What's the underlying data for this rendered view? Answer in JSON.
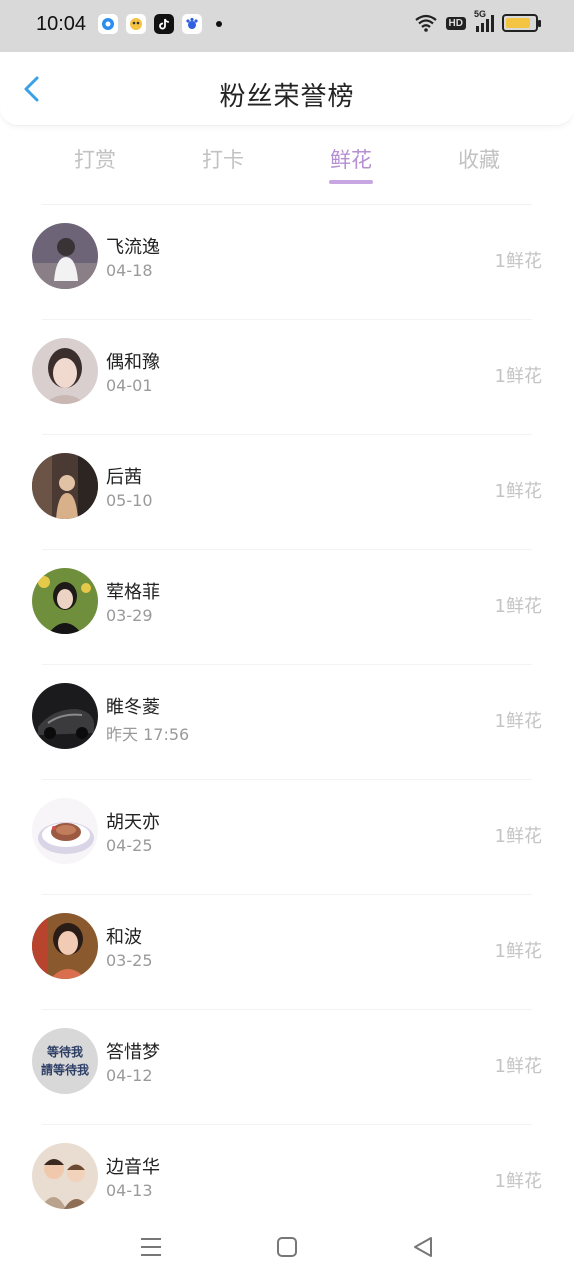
{
  "status": {
    "time": "10:04",
    "hd": "HD",
    "network": "5G",
    "battery_level": 0.85
  },
  "header": {
    "title": "粉丝荣誉榜",
    "back_icon": "chevron-left-icon"
  },
  "tabs": [
    {
      "label": "打赏",
      "active": false
    },
    {
      "label": "打卡",
      "active": false
    },
    {
      "label": "鲜花",
      "active": true
    },
    {
      "label": "收藏",
      "active": false
    }
  ],
  "colors": {
    "active_tab": "#b58fd4",
    "inactive_tab": "#c2c2c2",
    "back_icon": "#3aa0e8",
    "count_text": "#c4c4c4"
  },
  "fans": [
    {
      "name": "飞流逸",
      "date": "04-18",
      "count": "1鲜花"
    },
    {
      "name": "偶和豫",
      "date": "04-01",
      "count": "1鲜花"
    },
    {
      "name": "后茜",
      "date": "05-10",
      "count": "1鲜花"
    },
    {
      "name": "荤格菲",
      "date": "03-29",
      "count": "1鲜花"
    },
    {
      "name": "睢冬菱",
      "date": "昨天 17:56",
      "count": "1鲜花"
    },
    {
      "name": "胡天亦",
      "date": "04-25",
      "count": "1鲜花"
    },
    {
      "name": "和波",
      "date": "03-25",
      "count": "1鲜花"
    },
    {
      "name": "答惜梦",
      "date": "04-12",
      "count": "1鲜花",
      "avatar_text": [
        "等待我",
        "請等待我"
      ]
    },
    {
      "name": "边音华",
      "date": "04-13",
      "count": "1鲜花"
    }
  ],
  "navbar": {
    "items": [
      "menu-icon",
      "home-icon",
      "back-icon"
    ]
  }
}
